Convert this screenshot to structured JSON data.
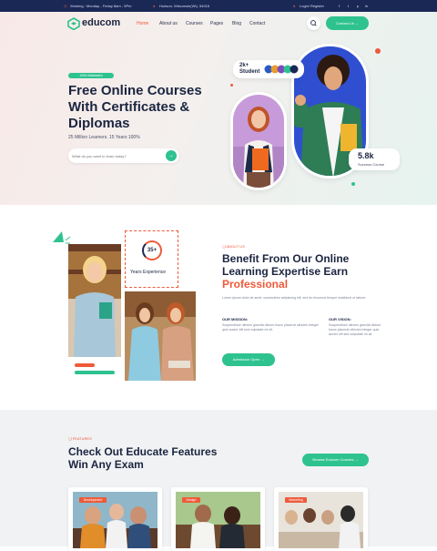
{
  "topbar": {
    "hours": "Working : Monday - Friday 8am - 5Pm",
    "address": "Hudson, Wisconsin(WI), 54016",
    "auth": "Login/ Register",
    "social": [
      "f",
      "t",
      "p",
      "in"
    ]
  },
  "header": {
    "logo": "educom",
    "nav": [
      "Home",
      "About us",
      "Courses",
      "Pages",
      "Blog",
      "Contact"
    ],
    "cta": "Contact Us"
  },
  "hero": {
    "tag": "100% Satisfaction",
    "title": [
      "Free Online Courses",
      "With Certificates &",
      "Diplomas"
    ],
    "subtitle": "25 Million Learners. 15 Years 100%",
    "search_placeholder": "What do you want to learn today?",
    "students_count": "2k+",
    "students_label": "Student",
    "success_count": "5.8k",
    "success_label": "Success Course"
  },
  "about": {
    "experience_number": "35+",
    "experience_label": "Years Experience",
    "eyebrow": "ABOUT US",
    "title": [
      "Benefit From Our Online",
      "Learning Expertise Earn"
    ],
    "title_highlight": "Professional",
    "text": "Lorem ipsum dolor sit amet, consectetur adipiscing elit, sed do eiusmod tempor incididunt ut labore.",
    "mission_title": "OUR MISSION:",
    "mission_text": "Suspendisse ultrices gravida dictum fusce placerat ultricies integer quis auctor elit sed vulputate mi sit.",
    "vision_title": "OUR VISION:",
    "vision_text": "Suspendisse ultrices gravida dictum fusce placerat ultricies integer quis auctor elit sed vulputate mi sit.",
    "cta": "Admission Open"
  },
  "features": {
    "eyebrow": "FEATURES",
    "title": [
      "Check Out Educate Features",
      "Win Any Exam"
    ],
    "cta": "Browse Educom Courses",
    "courses": [
      {
        "category": "Development"
      },
      {
        "category": "Design"
      },
      {
        "category": "Marketing"
      }
    ]
  },
  "colors": {
    "accent": "#2ec28f",
    "highlight": "#ee5a3a",
    "navy": "#1a2856"
  }
}
